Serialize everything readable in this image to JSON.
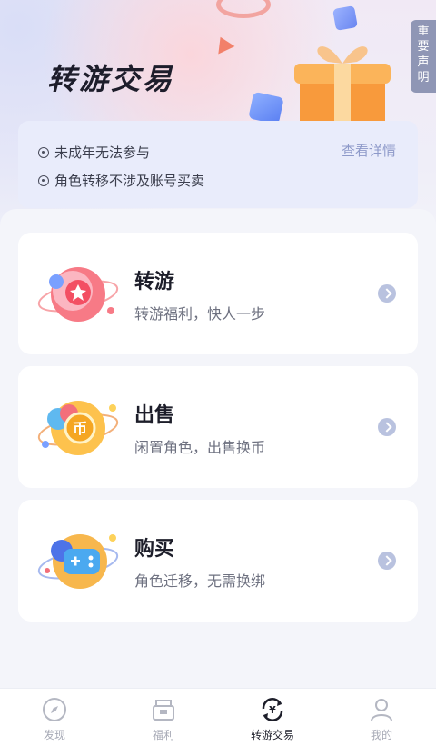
{
  "header": {
    "title": "转游交易",
    "notice_tab": [
      "重",
      "要",
      "声",
      "明"
    ]
  },
  "info": {
    "lines": [
      "未成年无法参与",
      "角色转移不涉及账号买卖"
    ],
    "detail_link": "查看详情"
  },
  "cards": [
    {
      "title": "转游",
      "subtitle": "转游福利，快人一步",
      "icon": "star-planet-icon"
    },
    {
      "title": "出售",
      "subtitle": "闲置角色，出售换币",
      "icon": "coin-planet-icon"
    },
    {
      "title": "购买",
      "subtitle": "角色迁移，无需换绑",
      "icon": "gamepad-planet-icon"
    }
  ],
  "tabbar": {
    "items": [
      {
        "label": "发现",
        "icon": "compass-icon",
        "active": false
      },
      {
        "label": "福利",
        "icon": "gift-box-icon",
        "active": false
      },
      {
        "label": "转游交易",
        "icon": "yuan-exchange-icon",
        "active": true
      },
      {
        "label": "我的",
        "icon": "user-icon",
        "active": false
      }
    ]
  },
  "colors": {
    "accent_link": "#8d99c9",
    "arrow": "#b9c2df",
    "tab_active": "#1d1e2a",
    "tab_inactive": "#a7aab6"
  }
}
